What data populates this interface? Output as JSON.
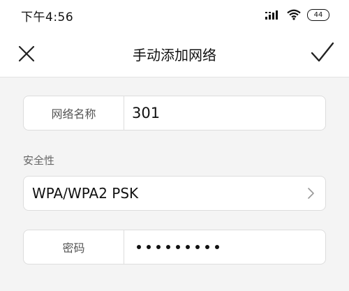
{
  "status_bar": {
    "time": "下午4:56",
    "battery": "44",
    "icons": [
      "signal-icon",
      "wifi-icon",
      "battery-icon"
    ]
  },
  "header": {
    "title": "手动添加网络",
    "close_icon": "close-icon",
    "confirm_icon": "check-icon"
  },
  "form": {
    "network_name": {
      "label": "网络名称",
      "value": "301"
    },
    "security": {
      "section_label": "安全性",
      "value": "WPA/WPA2 PSK",
      "icon": "chevron-right-icon"
    },
    "password": {
      "label": "密码",
      "masked_length": 9
    }
  }
}
